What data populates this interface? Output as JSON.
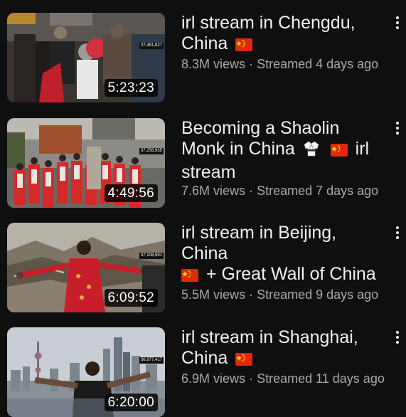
{
  "videos": [
    {
      "title": "irl stream in Chengdu, China",
      "title_lines": [
        "irl stream in Chengdu,",
        "China"
      ],
      "views": "8.3M views",
      "separator": "·",
      "streamed": "Streamed 4 days ago",
      "duration": "5:23:23",
      "viewer_count": "37,481,827"
    },
    {
      "title": "Becoming a Shaolin Monk in China irl stream",
      "title_lines": [
        "Becoming a Shaolin",
        "Monk in China",
        "irl",
        "stream"
      ],
      "views": "7.6M views",
      "separator": "·",
      "streamed": "Streamed 7 days ago",
      "duration": "4:49:56",
      "viewer_count": "37,256,935"
    },
    {
      "title": "irl stream in Beijing, China + Great Wall of China",
      "title_lines": [
        "irl stream in Beijing, China",
        "+ Great Wall of China"
      ],
      "views": "5.5M views",
      "separator": "·",
      "streamed": "Streamed 9 days ago",
      "duration": "6:09:52",
      "viewer_count": "37,106,591"
    },
    {
      "title": "irl stream in Shanghai, China",
      "title_lines": [
        "irl stream in Shanghai,",
        "China"
      ],
      "views": "6.9M views",
      "separator": "·",
      "streamed": "Streamed 11 days ago",
      "duration": "6:20:00",
      "viewer_count": "36,977,417"
    }
  ],
  "icons": {
    "flag": "china-flag-icon",
    "gi": "martial-arts-uniform-icon",
    "menu": "more-vertical-icon"
  },
  "colors": {
    "background": "#0f0f0f",
    "title": "#f1f1f1",
    "subtitle": "#aaaaaa",
    "flag_red": "#de2910",
    "flag_star": "#ffde00"
  }
}
